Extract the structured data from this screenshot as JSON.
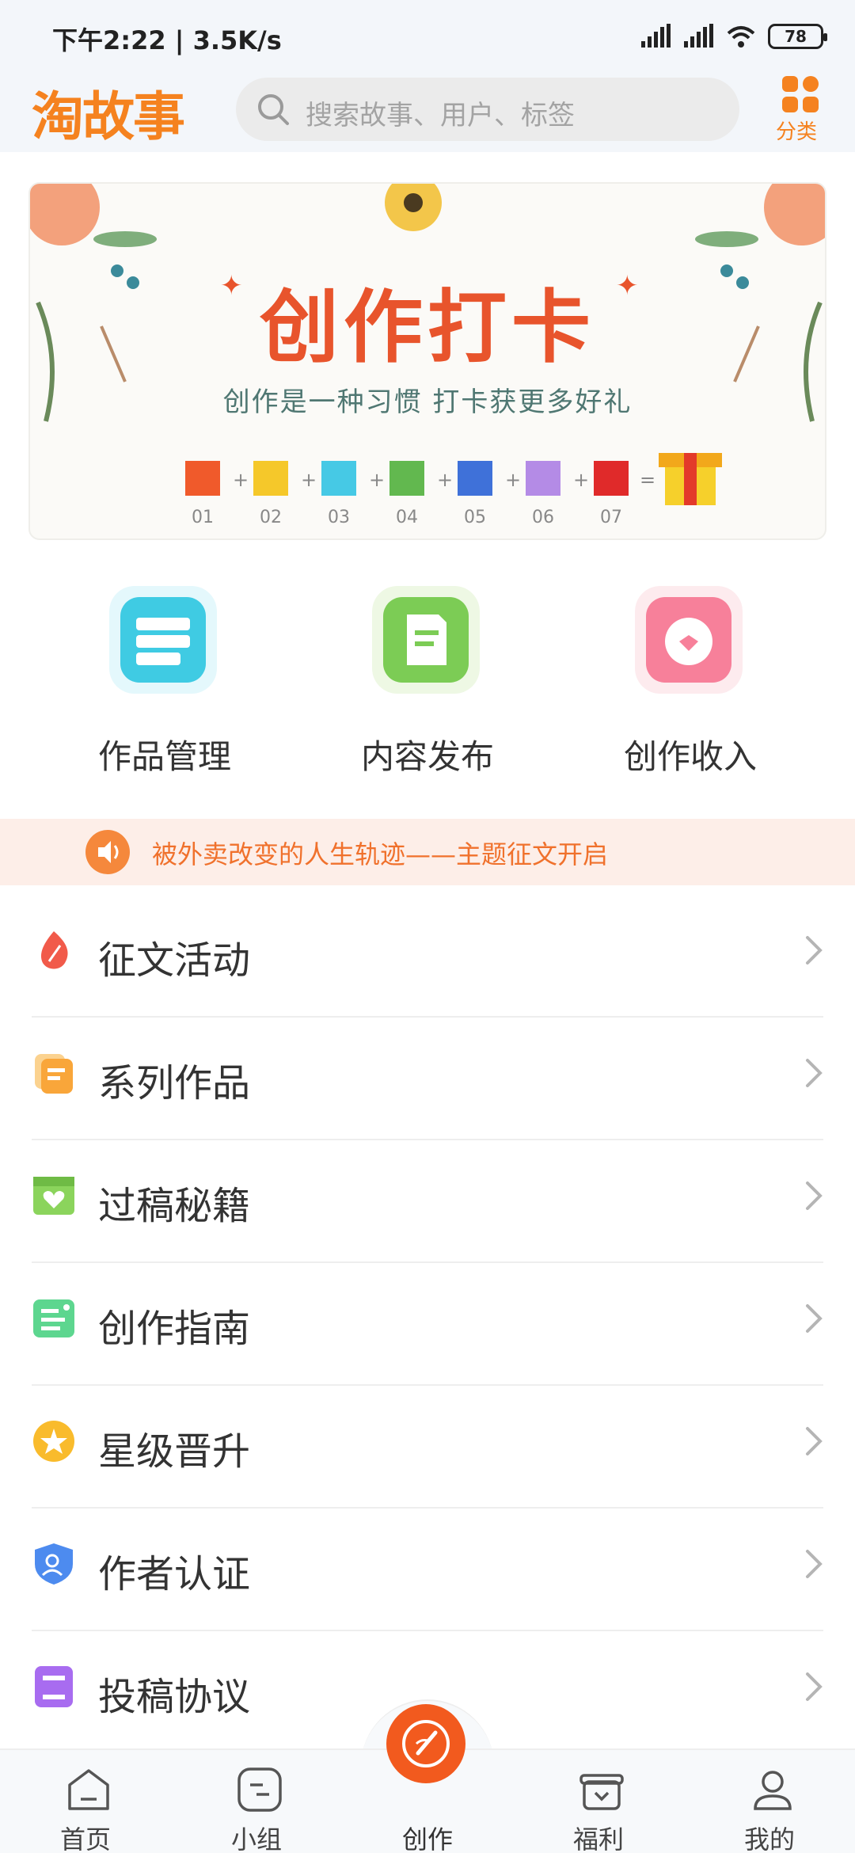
{
  "status_bar": {
    "time": "下午2:22 | 3.5K/s",
    "battery": "78"
  },
  "header": {
    "logo": "淘故事",
    "search_placeholder": "搜索故事、用户、标签",
    "category_label": "分类"
  },
  "banner": {
    "title": "创作打卡",
    "subtitle": "创作是一种习惯    打卡获更多好礼",
    "days": [
      "01",
      "02",
      "03",
      "04",
      "05",
      "06",
      "07"
    ]
  },
  "quick_actions": [
    {
      "label": "作品管理",
      "icon": "archive-icon",
      "color": "#3fcbe3"
    },
    {
      "label": "内容发布",
      "icon": "edit-document-icon",
      "color": "#7ccc55"
    },
    {
      "label": "创作收入",
      "icon": "wallet-icon",
      "color": "#f7809a"
    }
  ],
  "notice": {
    "text": "被外卖改变的人生轨迹——主题征文开启"
  },
  "menu": [
    {
      "label": "征文活动",
      "icon": "flame-quill-icon",
      "color": "#f15a4a"
    },
    {
      "label": "系列作品",
      "icon": "stacked-docs-icon",
      "color": "#f9a63a"
    },
    {
      "label": "过稿秘籍",
      "icon": "heart-box-icon",
      "color": "#8bd45c"
    },
    {
      "label": "创作指南",
      "icon": "guide-list-icon",
      "color": "#5dd68f"
    },
    {
      "label": "星级晋升",
      "icon": "star-icon",
      "color": "#f9bb2c"
    },
    {
      "label": "作者认证",
      "icon": "shield-user-icon",
      "color": "#4d8bef"
    },
    {
      "label": "投稿协议",
      "icon": "agreement-icon",
      "color": "#a86cf0"
    }
  ],
  "bottom_nav": [
    {
      "label": "首页",
      "icon": "home-icon"
    },
    {
      "label": "小组",
      "icon": "group-icon"
    },
    {
      "label": "创作",
      "icon": "create-icon"
    },
    {
      "label": "福利",
      "icon": "gift-icon"
    },
    {
      "label": "我的",
      "icon": "profile-icon"
    }
  ],
  "colors": {
    "brand": "#f5821f",
    "accent": "#f25a1e"
  }
}
